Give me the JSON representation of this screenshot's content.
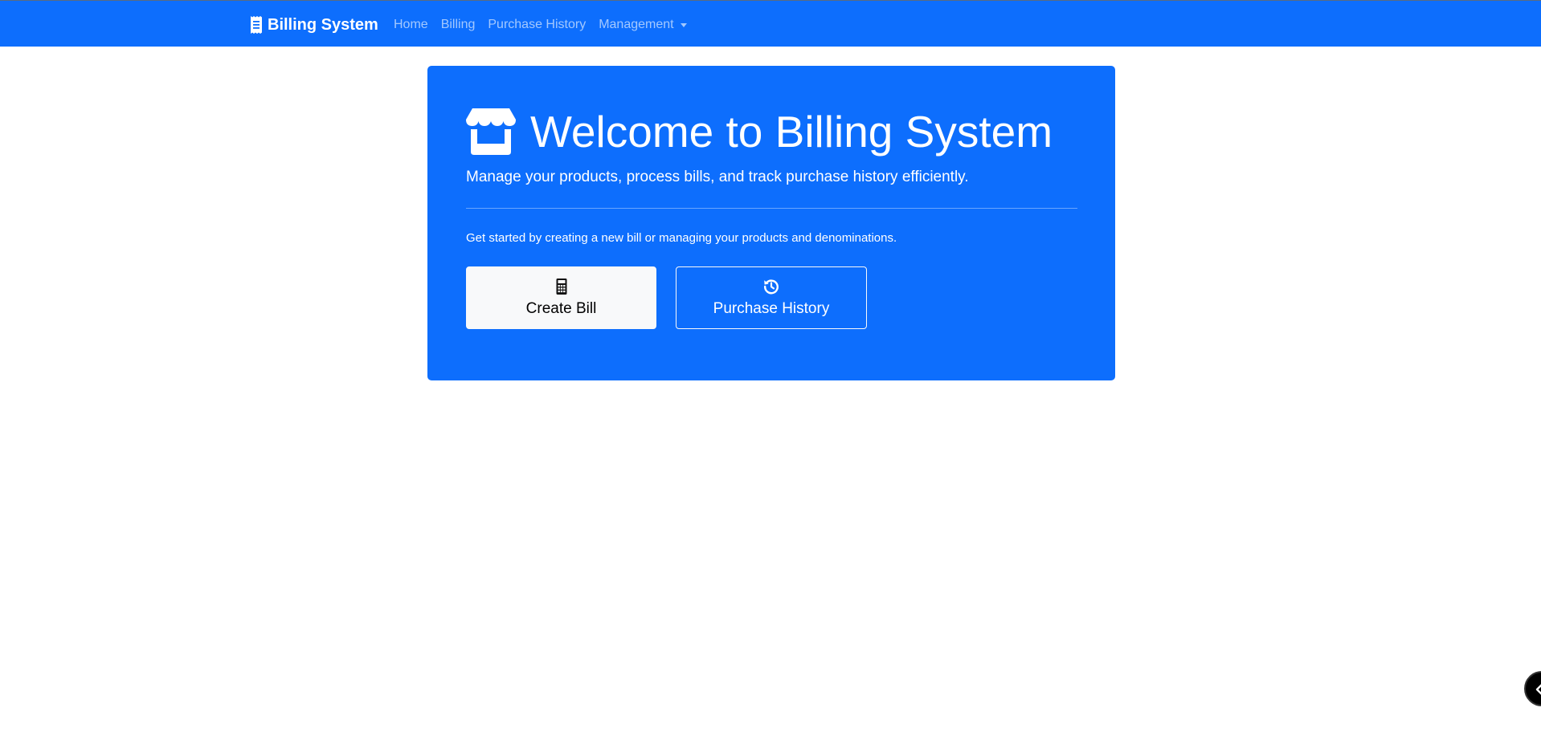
{
  "navbar": {
    "brand": "Billing System",
    "brand_icon": "receipt-icon",
    "links": [
      {
        "label": "Home"
      },
      {
        "label": "Billing"
      },
      {
        "label": "Purchase History"
      },
      {
        "label": "Management",
        "dropdown": true
      }
    ]
  },
  "hero": {
    "icon": "store-icon",
    "title": "Welcome to Billing System",
    "lead": "Manage your products, process bills, and track purchase history efficiently.",
    "description": "Get started by creating a new bill or managing your products and denominations.",
    "buttons": [
      {
        "label": "Create Bill",
        "icon": "calculator-icon"
      },
      {
        "label": "Purchase History",
        "icon": "history-icon"
      }
    ]
  },
  "colors": {
    "primary": "#0d6efd",
    "light": "#f8f9fa",
    "white": "#ffffff"
  }
}
